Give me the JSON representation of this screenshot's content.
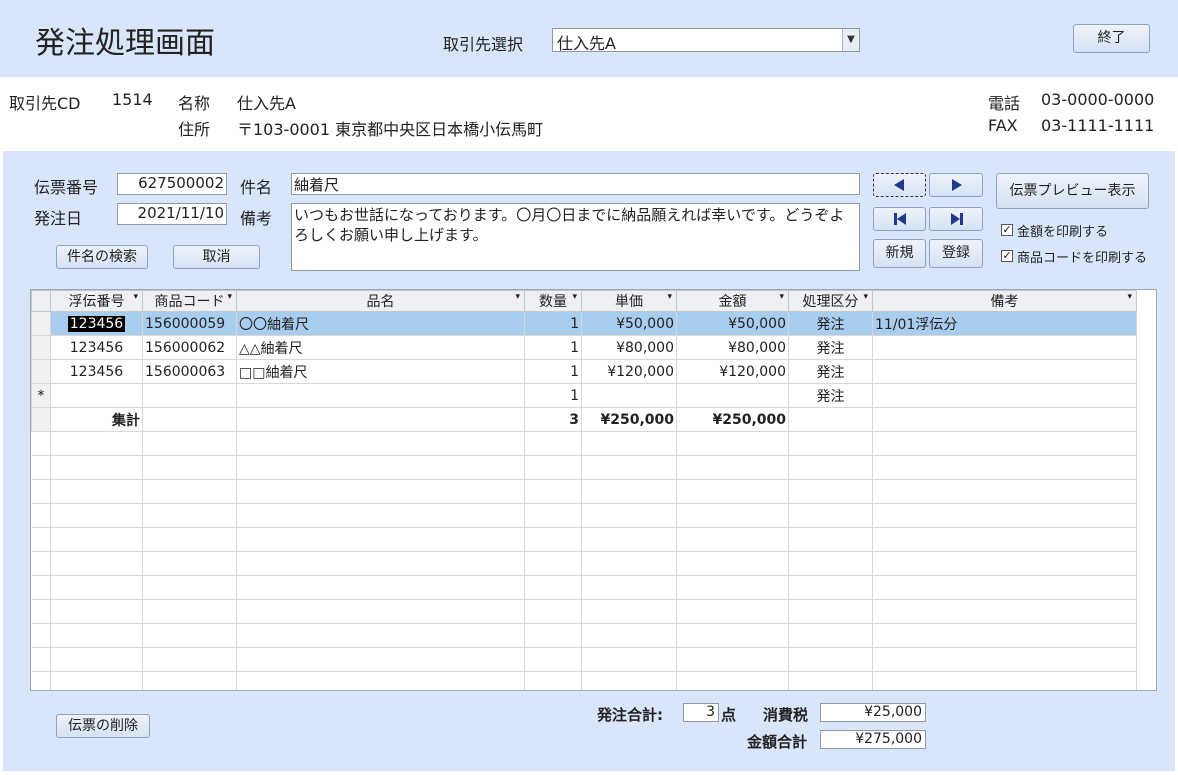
{
  "header": {
    "title": "発注処理画面",
    "supplier_select_label": "取引先選択",
    "supplier_selected": "仕入先A",
    "exit_button": "終了"
  },
  "supplier_info": {
    "code_label": "取引先CD",
    "code": "1514",
    "name_label": "名称",
    "name": "仕入先A",
    "address_label": "住所",
    "address": "〒103-0001 東京都中央区日本橋小伝馬町",
    "phone_label": "電話",
    "phone": "03-0000-0000",
    "fax_label": "FAX",
    "fax": "03-1111-1111"
  },
  "form": {
    "slip_no_label": "伝票番号",
    "slip_no": "627500002",
    "subject_label": "件名",
    "subject": "紬着尺",
    "order_date_label": "発注日",
    "order_date": "2021/11/10",
    "remarks_label": "備考",
    "remarks": "いつもお世話になっております。〇月〇日までに納品願えれば幸いです。どうぞよろしくお願い申し上げます。",
    "search_subject_button": "件名の検索",
    "cancel_button": "取消",
    "new_button": "新規",
    "register_button": "登録",
    "preview_button": "伝票プレビュー表示",
    "print_amount_label": "金額を印刷する",
    "print_code_label": "商品コードを印刷する"
  },
  "grid": {
    "columns": [
      "浮伝番号",
      "商品コード",
      "品名",
      "数量",
      "単価",
      "金額",
      "処理区分",
      "備考"
    ],
    "rows": [
      {
        "slip": "123456",
        "code": "156000059",
        "name": "〇〇紬着尺",
        "qty": "1",
        "price": "¥50,000",
        "amount": "¥50,000",
        "type": "発注",
        "note": "11/01浮伝分"
      },
      {
        "slip": "123456",
        "code": "156000062",
        "name": "△△紬着尺",
        "qty": "1",
        "price": "¥80,000",
        "amount": "¥80,000",
        "type": "発注",
        "note": ""
      },
      {
        "slip": "123456",
        "code": "156000063",
        "name": "□□紬着尺",
        "qty": "1",
        "price": "¥120,000",
        "amount": "¥120,000",
        "type": "発注",
        "note": ""
      }
    ],
    "new_row": {
      "marker": "*",
      "qty": "1",
      "type": "発注"
    },
    "total_row": {
      "label": "集計",
      "qty": "3",
      "price": "¥250,000",
      "amount": "¥250,000"
    }
  },
  "footer": {
    "delete_button": "伝票の削除",
    "order_total_label": "発注合計:",
    "order_total_count": "3",
    "unit": "点",
    "tax_label": "消費税",
    "tax": "¥25,000",
    "amount_total_label": "金額合計",
    "amount_total": "¥275,000"
  }
}
